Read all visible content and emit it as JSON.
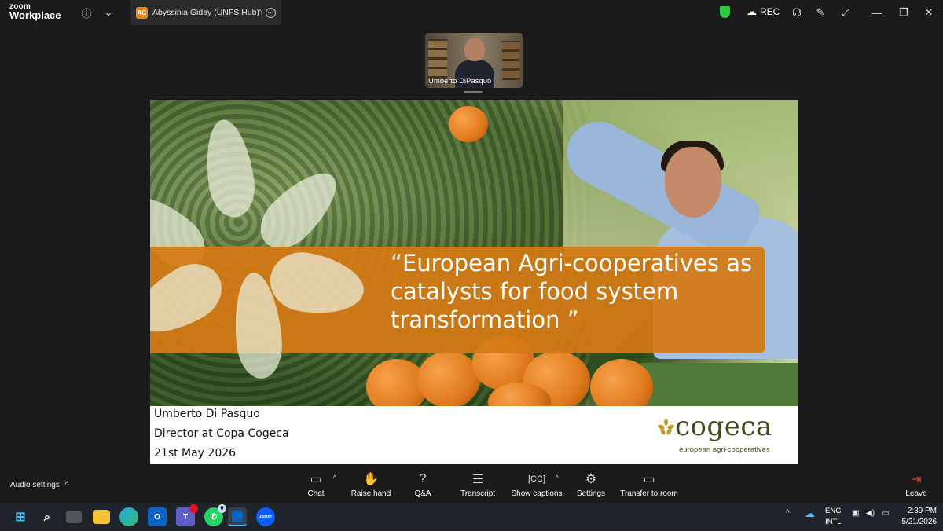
{
  "app": {
    "logo_line1": "zoom",
    "logo_line2": "Workplace",
    "tab_title": "Abyssinia Giday (UNFS Hub)'s scre",
    "tab_avatar": "AG",
    "rec_label": "REC"
  },
  "video": {
    "participant_name": "Umberto DiPasquo"
  },
  "slide": {
    "headline": "“European Agri-cooperatives as catalysts for food system transformation ”",
    "presenter_name": "Umberto Di Pasquo",
    "presenter_role": "Director at Copa Cogeca",
    "date": "21st May 2026",
    "brand_mark": "*",
    "brand_name": "cogeca",
    "brand_tagline": "european agri-cooperatives"
  },
  "controls": {
    "audio_settings": "Audio settings",
    "chat": "Chat",
    "raise_hand": "Raise hand",
    "qa": "Q&A",
    "transcript": "Transcript",
    "show_captions": "Show captions",
    "settings": "Settings",
    "transfer_to_room": "Transfer to room",
    "leave": "Leave"
  },
  "taskbar": {
    "whatsapp_badge": "6",
    "language_line1": "ENG",
    "language_line2": "INTL",
    "time": "2:39 PM",
    "date": "5/21/2026"
  },
  "colors": {
    "banner": "#d67a14",
    "brand_green": "#3d4f1c",
    "accent_yellow": "#c79a24"
  }
}
